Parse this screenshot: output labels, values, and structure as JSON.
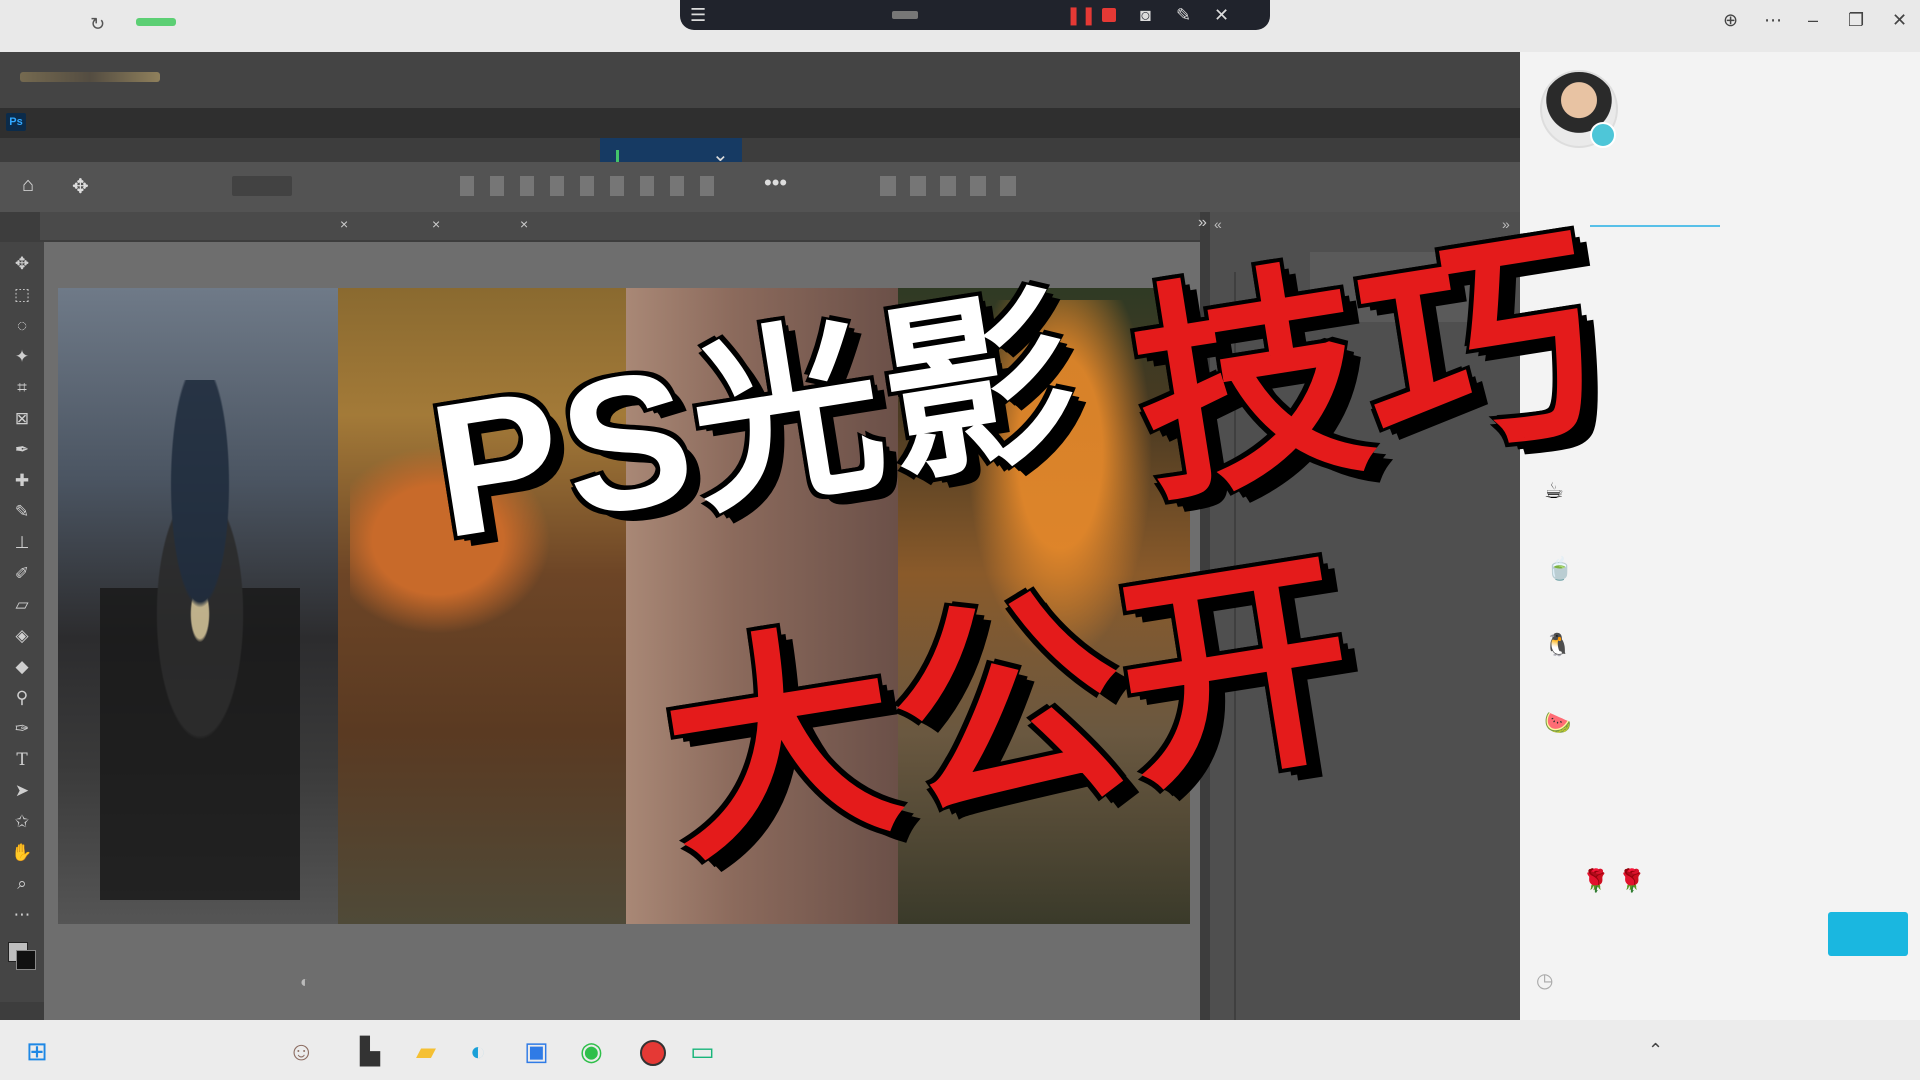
{
  "overlay": {
    "line1": "PS光影",
    "line2": "技巧",
    "line3": "大公开"
  },
  "colors": {
    "accent_red": "#e41b1b",
    "accent_cyan": "#1ab7e0",
    "ps_dark": "#3d3d3d"
  },
  "recording_bar": {
    "icons": [
      "menu-icon",
      "pause-icon",
      "stop-icon",
      "camera-icon",
      "pen-icon",
      "close-icon"
    ]
  },
  "photoshop": {
    "app_badge": "Ps",
    "tools": [
      "move-tool-icon",
      "marquee-tool-icon",
      "lasso-tool-icon",
      "quick-select-icon",
      "crop-tool-icon",
      "frame-tool-icon",
      "eyedropper-icon",
      "healing-brush-icon",
      "brush-tool-icon",
      "stamp-tool-icon",
      "history-brush-icon",
      "eraser-icon",
      "paint-bucket-icon",
      "blur-tool-icon",
      "dodge-tool-icon",
      "pen-tool-icon",
      "type-tool-icon",
      "path-select-icon",
      "shape-tool-icon",
      "hand-tool-icon",
      "zoom-tool-icon",
      "more-tools-icon"
    ]
  },
  "taskbar": {
    "icons": [
      "windows-start-icon",
      "user-app-icon",
      "terminal-icon",
      "file-explorer-icon",
      "edge-browser-icon",
      "meeting-app-icon",
      "wechat-icon",
      "record-icon",
      "screen-share-icon"
    ]
  }
}
